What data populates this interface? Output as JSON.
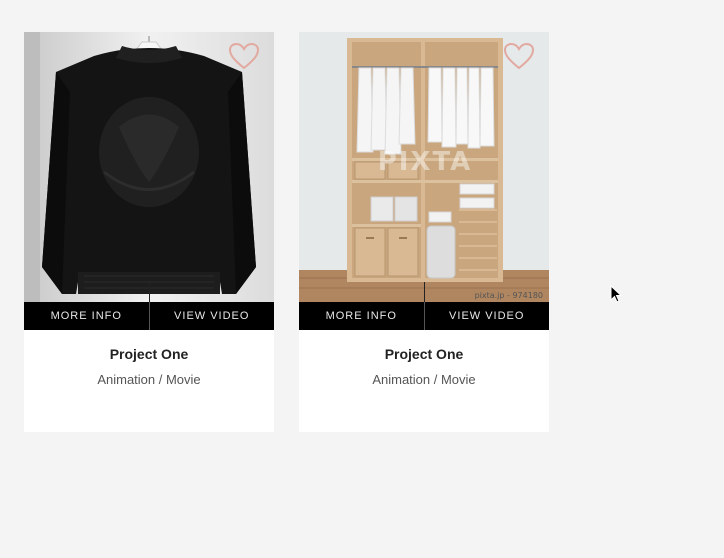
{
  "cards": [
    {
      "title": "Project One",
      "subtitle": "Animation / Movie",
      "more_info_label": "MORE INFO",
      "view_video_label": "VIEW VIDEO",
      "image_subject": "black bomber jacket on hanger",
      "favorite": false
    },
    {
      "title": "Project One",
      "subtitle": "Animation / Movie",
      "more_info_label": "MORE INFO",
      "view_video_label": "VIEW VIDEO",
      "image_subject": "wooden wardrobe with white shirts",
      "watermark_text": "PIXTA",
      "watermark_caption": "pixta.jp - 974180",
      "favorite": false
    }
  ],
  "icons": {
    "favorite": "heart-outline-icon",
    "cursor": "mouse-pointer-icon"
  },
  "colors": {
    "page_background": "#f4f4f4",
    "card_background": "#ffffff",
    "action_bar": "#000000",
    "heart_stroke": "#e2a9a0"
  }
}
